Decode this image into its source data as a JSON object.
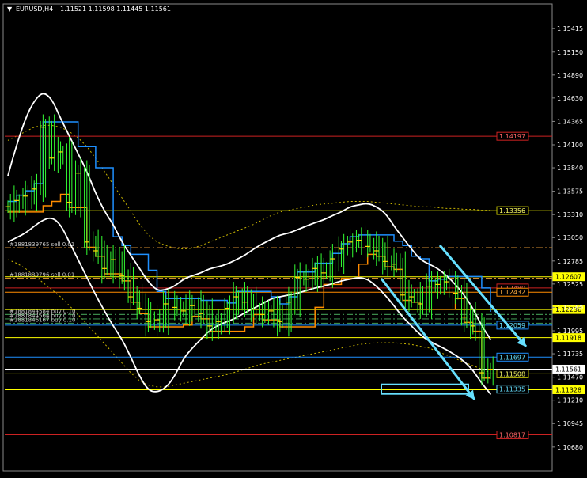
{
  "header": {
    "arrow": "▼",
    "symbol": "EURUSD,H4",
    "ohlc": "1.11521 1.11598 1.11445 1.11561"
  },
  "colors": {
    "background": "#000000",
    "frame": "#8a8a8a",
    "candles": "#33ff33",
    "bollinger": "#ffffff",
    "dotted_band": "#c8b400",
    "donchian_blue": "#1e90ff",
    "donchian_orange": "#ff8c00",
    "signal_yellow": "#ffd700",
    "trend_arrows": "#66e0ff",
    "hline_yellow": "#ffff00",
    "hline_red": "#cc2222",
    "hline_cyan": "#1e90ff",
    "order_dash_orange": "#d08a30",
    "order_dash_green": "#3a8a4a"
  },
  "chart_data": {
    "type": "candlestick",
    "symbol": "EURUSD",
    "timeframe": "H4",
    "ylim": [
      1.1058,
      1.1556
    ],
    "y_ticks": [
      "1.15415",
      "1.15150",
      "1.14890",
      "1.14630",
      "1.14365",
      "1.14100",
      "1.13840",
      "1.13575",
      "1.13310",
      "1.13050",
      "1.12785",
      "1.12525",
      "1.12260",
      "1.11995",
      "1.11735",
      "1.11470",
      "1.11210",
      "1.10945",
      "1.10680"
    ],
    "price_levels": [
      {
        "value": 1.14197,
        "label": "1.14197",
        "color": "#cc2222",
        "text_color": "#ff6666",
        "box": "#cc2222"
      },
      {
        "value": 1.13356,
        "label": "1.13356",
        "color": "#bbbb00",
        "text_color": "#ffff66",
        "box": "#bbbb00"
      },
      {
        "value": 1.12607,
        "label": "1.12607",
        "color": "#ffff00",
        "text_color": "#000000",
        "box": "#ffff00",
        "filled": true
      },
      {
        "value": 1.1248,
        "label": "1.12480",
        "color": "#cc2222",
        "text_color": "#ff6666",
        "box": "#cc2222"
      },
      {
        "value": 1.12432,
        "label": "1.12432",
        "color": "#ff8c00",
        "text_color": "#ffae40",
        "box": "#ff8c00"
      },
      {
        "value": 1.12236,
        "label": "1.12236",
        "color": "#ffff00",
        "text_color": "#000000",
        "box": "#ffff00",
        "filled": true
      },
      {
        "value": 1.12059,
        "label": "1.12059",
        "color": "#1e90ff",
        "text_color": "#66e0ff",
        "box": "#1e90ff"
      },
      {
        "value": 1.11918,
        "label": "1.11918",
        "color": "#ffff00",
        "text_color": "#000000",
        "box": "#ffff00",
        "filled": true
      },
      {
        "value": 1.11697,
        "label": "1.11697",
        "color": "#1e90ff",
        "text_color": "#66e0ff",
        "box": "#1e90ff"
      },
      {
        "value": 1.11561,
        "label": "1.11561",
        "color": "#ffffff",
        "text_color": "#000000",
        "box": "#ffffff",
        "filled": true
      },
      {
        "value": 1.11508,
        "label": "1.11508",
        "color": "#bbbb00",
        "text_color": "#ffff66",
        "box": "#bbbb00"
      },
      {
        "value": 1.11328,
        "label": "1.11328",
        "color": "#ffff00",
        "text_color": "#000000",
        "box": "#ffff00",
        "filled": true
      },
      {
        "value": 1.11335,
        "label": "1.11335",
        "color": "#66e0ff",
        "text_color": "#66e0ff",
        "box": "#66e0ff"
      },
      {
        "value": 1.10817,
        "label": "1.10817",
        "color": "#cc2222",
        "text_color": "#ff6666",
        "box": "#cc2222"
      }
    ],
    "orders": [
      {
        "label": "#1881839765 sell 0.01",
        "value": 1.12935,
        "style": "orange"
      },
      {
        "label": "#1881839796 sell 0.01",
        "value": 1.1259,
        "style": "orange"
      },
      {
        "label": "#1881844584 buy 0.10",
        "value": 1.1218,
        "style": "green"
      },
      {
        "label": "#1881844564 buy 0.10",
        "value": 1.1213,
        "style": "green"
      },
      {
        "label": "#1881846167 buy 0.10",
        "value": 1.1208,
        "style": "green"
      }
    ],
    "series": [
      {
        "key": "close",
        "values": [
          1.134,
          1.1347,
          1.1352,
          1.136,
          1.143,
          1.1395,
          1.1402,
          1.1345,
          1.1378,
          1.13,
          1.129,
          1.127,
          1.128,
          1.1262,
          1.1238,
          1.1225,
          1.121,
          1.1212,
          1.123,
          1.1226,
          1.1222,
          1.1228,
          1.1219,
          1.1205,
          1.121,
          1.1225,
          1.1238,
          1.1232,
          1.1224,
          1.1218,
          1.1222,
          1.121,
          1.1232,
          1.126,
          1.1258,
          1.127,
          1.1265,
          1.1281,
          1.1292,
          1.13,
          1.1302,
          1.1295,
          1.129,
          1.1278,
          1.1275,
          1.124,
          1.1238,
          1.123,
          1.125,
          1.1252,
          1.1255,
          1.1242,
          1.1215,
          1.1205,
          1.1152,
          1.1156
        ]
      },
      {
        "key": "upper_band",
        "values": [
          1.1375,
          1.141,
          1.144,
          1.146,
          1.147,
          1.1462,
          1.144,
          1.142,
          1.14,
          1.138,
          1.1355,
          1.1335,
          1.132,
          1.13,
          1.1285,
          1.127,
          1.1255,
          1.1245,
          1.1246,
          1.125,
          1.1258,
          1.1262,
          1.1265,
          1.127,
          1.1272,
          1.1275,
          1.128,
          1.1285,
          1.1292,
          1.1298,
          1.1303,
          1.1308,
          1.131,
          1.1314,
          1.1318,
          1.1322,
          1.1325,
          1.133,
          1.1334,
          1.134,
          1.1342,
          1.1344,
          1.134,
          1.1333,
          1.1318,
          1.1305,
          1.1292,
          1.128,
          1.1275,
          1.127,
          1.1262,
          1.1252,
          1.124,
          1.1225,
          1.1205,
          1.119
        ]
      },
      {
        "key": "lower_band",
        "values": [
          1.13,
          1.1305,
          1.131,
          1.1318,
          1.1325,
          1.1328,
          1.132,
          1.13,
          1.128,
          1.126,
          1.124,
          1.1222,
          1.1205,
          1.119,
          1.117,
          1.1148,
          1.1132,
          1.113,
          1.1135,
          1.1148,
          1.1168,
          1.118,
          1.119,
          1.12,
          1.1206,
          1.121,
          1.1214,
          1.122,
          1.1225,
          1.123,
          1.1236,
          1.1238,
          1.124,
          1.1242,
          1.1245,
          1.1248,
          1.125,
          1.1253,
          1.1256,
          1.1258,
          1.126,
          1.1258,
          1.125,
          1.124,
          1.1228,
          1.1215,
          1.1205,
          1.1195,
          1.1188,
          1.1183,
          1.1178,
          1.1172,
          1.1165,
          1.1155,
          1.114,
          1.1128
        ]
      },
      {
        "key": "dotted_upper",
        "values": [
          1.1415,
          1.142,
          1.1425,
          1.143,
          1.1432,
          1.1432,
          1.143,
          1.1425,
          1.1418,
          1.1408,
          1.1395,
          1.138,
          1.1365,
          1.135,
          1.1335,
          1.132,
          1.1308,
          1.13,
          1.1296,
          1.1293,
          1.1292,
          1.1293,
          1.1296,
          1.13,
          1.1304,
          1.1308,
          1.1312,
          1.1316,
          1.132,
          1.1325,
          1.133,
          1.1334,
          1.1336,
          1.1338,
          1.134,
          1.1342,
          1.1343,
          1.1344,
          1.1345,
          1.1346,
          1.1346,
          1.1346,
          1.1345,
          1.1344,
          1.1343,
          1.1342,
          1.1341,
          1.134,
          1.134,
          1.1339,
          1.1338,
          1.1338,
          1.1337,
          1.1337,
          1.1336,
          1.1336
        ]
      },
      {
        "key": "dotted_lower",
        "values": [
          1.128,
          1.1276,
          1.127,
          1.1262,
          1.1254,
          1.1246,
          1.1238,
          1.1228,
          1.1218,
          1.1207,
          1.1196,
          1.1185,
          1.1174,
          1.1163,
          1.1152,
          1.1143,
          1.1138,
          1.1136,
          1.1136,
          1.1138,
          1.114,
          1.1142,
          1.1144,
          1.1146,
          1.1148,
          1.115,
          1.1153,
          1.1156,
          1.1159,
          1.1162,
          1.1164,
          1.1166,
          1.1168,
          1.117,
          1.1172,
          1.1174,
          1.1176,
          1.1178,
          1.118,
          1.1182,
          1.1184,
          1.1185,
          1.1186,
          1.1186,
          1.1186,
          1.1185,
          1.1184,
          1.1182,
          1.118,
          1.1176,
          1.1172,
          1.1168,
          1.1164,
          1.116,
          1.1156,
          1.1152
        ]
      }
    ]
  }
}
